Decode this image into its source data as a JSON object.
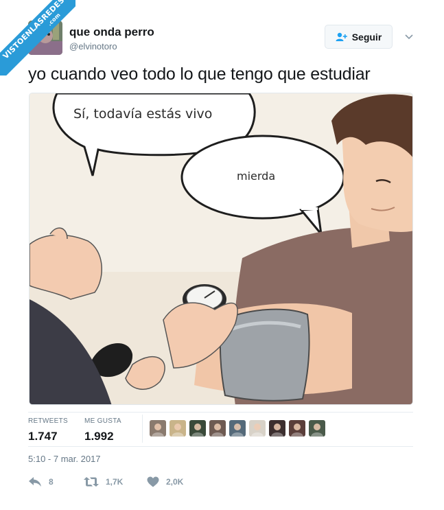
{
  "watermark": {
    "line1": "VISTOENLASREDES",
    "line2": ".com"
  },
  "user": {
    "name": "que onda perro",
    "handle": "@elvinotoro"
  },
  "follow": {
    "label": "Seguir"
  },
  "tweet": {
    "text": "yo cuando veo todo lo que tengo que estudiar"
  },
  "media": {
    "bubble1": "Sí, todavía estás vivo",
    "bubble2": "mierda"
  },
  "stats": {
    "retweets_label": "RETWEETS",
    "retweets_value": "1.747",
    "likes_label": "ME GUSTA",
    "likes_value": "1.992"
  },
  "likers": [
    {
      "color": "#8a7a6e"
    },
    {
      "color": "#c9b48a"
    },
    {
      "color": "#3a4a3a"
    },
    {
      "color": "#6e5a52"
    },
    {
      "color": "#556a7a"
    },
    {
      "color": "#d8d2c8"
    },
    {
      "color": "#3c2f2f"
    },
    {
      "color": "#5a3e3a"
    },
    {
      "color": "#4a5a4a"
    }
  ],
  "timestamp": "5:10 - 7 mar. 2017",
  "actions": {
    "reply_count": "8",
    "retweet_count": "1,7K",
    "like_count": "2,0K"
  },
  "colors": {
    "accent": "#1da1f2",
    "muted": "#657786",
    "ribbon": "#2a9bd8"
  },
  "icons": [
    "add-user-icon",
    "chevron-down-icon",
    "reply-icon",
    "retweet-icon",
    "heart-icon"
  ]
}
